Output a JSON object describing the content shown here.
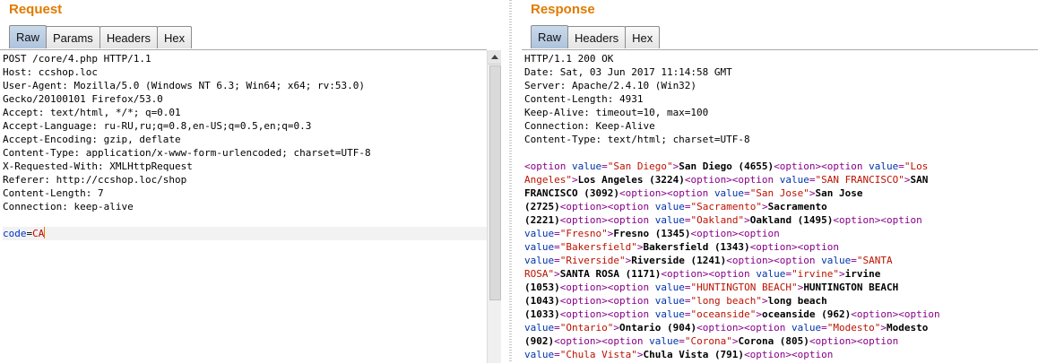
{
  "request": {
    "title": "Request",
    "tabs": [
      "Raw",
      "Params",
      "Headers",
      "Hex"
    ],
    "active_tab": "Raw",
    "lines": [
      "POST /core/4.php HTTP/1.1",
      "Host: ccshop.loc",
      "User-Agent: Mozilla/5.0 (Windows NT 6.3; Win64; x64; rv:53.0)",
      "Gecko/20100101 Firefox/53.0",
      "Accept: text/html, */*; q=0.01",
      "Accept-Language: ru-RU,ru;q=0.8,en-US;q=0.5,en;q=0.3",
      "Accept-Encoding: gzip, deflate",
      "Content-Type: application/x-www-form-urlencoded; charset=UTF-8",
      "X-Requested-With: XMLHttpRequest",
      "Referer: http://ccshop.loc/shop",
      "Content-Length: 7",
      "Connection: keep-alive",
      ""
    ],
    "body_param_name": "code",
    "body_param_value": "CA"
  },
  "response": {
    "title": "Response",
    "tabs": [
      "Raw",
      "Headers",
      "Hex"
    ],
    "active_tab": "Raw",
    "lines": [
      "HTTP/1.1 200 OK",
      "Date: Sat, 03 Jun 2017 11:14:58 GMT",
      "Server: Apache/2.4.10 (Win32)",
      "Content-Length: 4931",
      "Keep-Alive: timeout=10, max=100",
      "Connection: Keep-Alive",
      "Content-Type: text/html; charset=UTF-8",
      ""
    ],
    "body_rows": [
      [
        [
          "t",
          "<option "
        ],
        [
          "a",
          "value"
        ],
        [
          "t",
          "="
        ],
        [
          "s",
          "\"San Diego\""
        ],
        [
          "t",
          ">"
        ],
        [
          "x",
          "San Diego (4655)"
        ],
        [
          "t",
          "<option><option "
        ],
        [
          "a",
          "value"
        ],
        [
          "t",
          "="
        ],
        [
          "s",
          "\"Los"
        ]
      ],
      [
        [
          "s",
          "Angeles\""
        ],
        [
          "t",
          ">"
        ],
        [
          "x",
          "Los Angeles (3224)"
        ],
        [
          "t",
          "<option><option "
        ],
        [
          "a",
          "value"
        ],
        [
          "t",
          "="
        ],
        [
          "s",
          "\"SAN FRANCISCO\""
        ],
        [
          "t",
          ">"
        ],
        [
          "x",
          "SAN"
        ]
      ],
      [
        [
          "x",
          "FRANCISCO (3092)"
        ],
        [
          "t",
          "<option><option "
        ],
        [
          "a",
          "value"
        ],
        [
          "t",
          "="
        ],
        [
          "s",
          "\"San Jose\""
        ],
        [
          "t",
          ">"
        ],
        [
          "x",
          "San Jose"
        ]
      ],
      [
        [
          "x",
          "(2725)"
        ],
        [
          "t",
          "<option><option "
        ],
        [
          "a",
          "value"
        ],
        [
          "t",
          "="
        ],
        [
          "s",
          "\"Sacramento\""
        ],
        [
          "t",
          ">"
        ],
        [
          "x",
          "Sacramento"
        ]
      ],
      [
        [
          "x",
          "(2221)"
        ],
        [
          "t",
          "<option><option "
        ],
        [
          "a",
          "value"
        ],
        [
          "t",
          "="
        ],
        [
          "s",
          "\"Oakland\""
        ],
        [
          "t",
          ">"
        ],
        [
          "x",
          "Oakland (1495)"
        ],
        [
          "t",
          "<option><option"
        ]
      ],
      [
        [
          "a",
          "value"
        ],
        [
          "t",
          "="
        ],
        [
          "s",
          "\"Fresno\""
        ],
        [
          "t",
          ">"
        ],
        [
          "x",
          "Fresno (1345)"
        ],
        [
          "t",
          "<option><option"
        ]
      ],
      [
        [
          "a",
          "value"
        ],
        [
          "t",
          "="
        ],
        [
          "s",
          "\"Bakersfield\""
        ],
        [
          "t",
          ">"
        ],
        [
          "x",
          "Bakersfield (1343)"
        ],
        [
          "t",
          "<option><option"
        ]
      ],
      [
        [
          "a",
          "value"
        ],
        [
          "t",
          "="
        ],
        [
          "s",
          "\"Riverside\""
        ],
        [
          "t",
          ">"
        ],
        [
          "x",
          "Riverside (1241)"
        ],
        [
          "t",
          "<option><option "
        ],
        [
          "a",
          "value"
        ],
        [
          "t",
          "="
        ],
        [
          "s",
          "\"SANTA"
        ]
      ],
      [
        [
          "s",
          "ROSA\""
        ],
        [
          "t",
          ">"
        ],
        [
          "x",
          "SANTA ROSA (1171)"
        ],
        [
          "t",
          "<option><option "
        ],
        [
          "a",
          "value"
        ],
        [
          "t",
          "="
        ],
        [
          "s",
          "\"irvine\""
        ],
        [
          "t",
          ">"
        ],
        [
          "x",
          "irvine"
        ]
      ],
      [
        [
          "x",
          "(1053)"
        ],
        [
          "t",
          "<option><option "
        ],
        [
          "a",
          "value"
        ],
        [
          "t",
          "="
        ],
        [
          "s",
          "\"HUNTINGTON BEACH\""
        ],
        [
          "t",
          ">"
        ],
        [
          "x",
          "HUNTINGTON BEACH"
        ]
      ],
      [
        [
          "x",
          "(1043)"
        ],
        [
          "t",
          "<option><option "
        ],
        [
          "a",
          "value"
        ],
        [
          "t",
          "="
        ],
        [
          "s",
          "\"long beach\""
        ],
        [
          "t",
          ">"
        ],
        [
          "x",
          "long beach"
        ]
      ],
      [
        [
          "x",
          "(1033)"
        ],
        [
          "t",
          "<option><option "
        ],
        [
          "a",
          "value"
        ],
        [
          "t",
          "="
        ],
        [
          "s",
          "\"oceanside\""
        ],
        [
          "t",
          ">"
        ],
        [
          "x",
          "oceanside (962)"
        ],
        [
          "t",
          "<option><option"
        ]
      ],
      [
        [
          "a",
          "value"
        ],
        [
          "t",
          "="
        ],
        [
          "s",
          "\"Ontario\""
        ],
        [
          "t",
          ">"
        ],
        [
          "x",
          "Ontario (904)"
        ],
        [
          "t",
          "<option><option "
        ],
        [
          "a",
          "value"
        ],
        [
          "t",
          "="
        ],
        [
          "s",
          "\"Modesto\""
        ],
        [
          "t",
          ">"
        ],
        [
          "x",
          "Modesto"
        ]
      ],
      [
        [
          "x",
          "(902)"
        ],
        [
          "t",
          "<option><option "
        ],
        [
          "a",
          "value"
        ],
        [
          "t",
          "="
        ],
        [
          "s",
          "\"Corona\""
        ],
        [
          "t",
          ">"
        ],
        [
          "x",
          "Corona (805)"
        ],
        [
          "t",
          "<option><option"
        ]
      ],
      [
        [
          "a",
          "value"
        ],
        [
          "t",
          "="
        ],
        [
          "s",
          "\"Chula Vista\""
        ],
        [
          "t",
          ">"
        ],
        [
          "x",
          "Chula Vista (791)"
        ],
        [
          "t",
          "<option><option"
        ]
      ]
    ]
  },
  "colors": {
    "title": "#e07b00",
    "active_tab": "#aec3dc",
    "tag": "#880088",
    "attribute": "#0033aa",
    "string": "#bb1100",
    "param_name": "#0033cc",
    "param_value": "#cc0000"
  }
}
